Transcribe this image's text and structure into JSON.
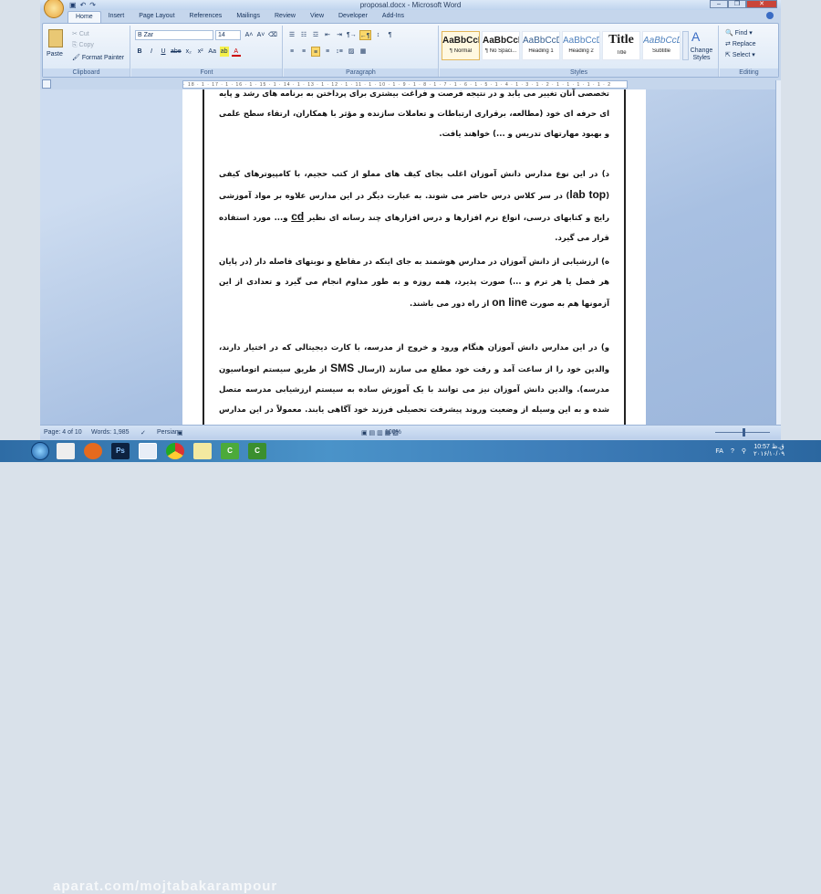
{
  "window": {
    "title": "proposal.docx - Microsoft Word"
  },
  "tabs": [
    "Home",
    "Insert",
    "Page Layout",
    "References",
    "Mailings",
    "Review",
    "View",
    "Developer",
    "Add-Ins"
  ],
  "clipboard": {
    "paste": "Paste",
    "cut": "Cut",
    "copy": "Copy",
    "format_painter": "Format Painter",
    "label": "Clipboard"
  },
  "font": {
    "name": "B Zar",
    "size": "14",
    "label": "Font",
    "buttons": [
      "B",
      "I",
      "U",
      "abe",
      "x₂",
      "x²",
      "Aa",
      "ab",
      "A"
    ]
  },
  "paragraph": {
    "label": "Paragraph"
  },
  "styles": {
    "label": "Styles",
    "items": [
      {
        "sample": "AaBbCcDdEe",
        "name": "¶ Normal"
      },
      {
        "sample": "AaBbCcDdEe",
        "name": "¶ No Spaci..."
      },
      {
        "sample": "AaBbCcDdEe",
        "name": "Heading 1"
      },
      {
        "sample": "AaBbCcDdEe",
        "name": "Heading 2"
      },
      {
        "sample": "Title",
        "name": "Title"
      },
      {
        "sample": "AaBbCcDdEe",
        "name": "Subtitle"
      }
    ],
    "change_styles": "Change Styles"
  },
  "editing": {
    "label": "Editing",
    "find": "Find",
    "replace": "Replace",
    "select": "Select"
  },
  "ruler": "· 18 · 1 · 17 · 1 · 16 · 1 · 15 · 1 · 14 · 1 · 13 · 1 · 12 · 1 · 11 · 1 · 10 · 1 · 9 · 1 · 8 · 1 · 7 · 1 · 6 · 1 · 5 · 1 · 4 · 1 · 3 · 1 · 2 · 1 · 1 · 1 · 1 · 1 · 2",
  "document": {
    "p1": "تخصصی آنان تغییر می یابد و در نتیجه فرصت و فراغت بیشتری برای پرداختن به برنامه های رشد و پایه ای حرفه ای خود (مطالعه، برقراری ارتباطات و تعاملات سازنده و مؤثر با همکاران، ارتقاء سطح علمی و بهبود مهارتهای تدریس و ...) خواهند یافت.",
    "p2a": "د) در این نوع مدارس دانش آموزان اغلب بجای کیف های مملو از کتب حجیم، با کامپیوترهای کیفی (",
    "p2_lab": "lab",
    "p2_top": "top",
    "p2b": ") در سر کلاس درس حاضر می شوند. به عبارت دیگر در این مدارس علاوه بر مواد آموزشی رایج و کتابهای درسی، انواع نرم افزارها و درس افزارهای چند رسانه ای نظیر ",
    "p2_cd": "cd",
    "p2c": " و... مورد استفاده قرار می گیرد.",
    "p3a": "ه) ارزشیابی از دانش آموزان در مدارس هوشمند به جای اینکه در مقاطع و نوبتهای فاصله دار (در پایان هر فصل یا هر ترم و ...) صورت پذیرد، همه روزه و به طور مداوم انجام می گیرد و تعدادی از این آزمونها هم به صورت ",
    "p3_online": "on line",
    "p3b": " از راه دور می باشند.",
    "p4a": "و) در این مدارس دانش آموزان هنگام ورود و خروج از مدرسه، با کارت دیجیتالی که در اختیار دارند، والدین خود را از ساعت آمد و رفت خود مطلع می سازند (ارسال ",
    "p4_sms": "SMS",
    "p4b": " از طریق سیستم اتوماسیون مدرسه). والدین دانش آموزان نیز می توانند با یک آموزش ساده به سیستم ارزشیابی مدرسه متصل شده و به این وسیله از وضعیت وروند پیشرفت تحصیلی فرزند خود آگاهی یابند. معمولاً در این مدارس روزانه در پایان ساعات"
  },
  "status": {
    "page": "Page: 4 of 10",
    "words": "Words: 1,985",
    "language": "Persian",
    "zoom": "100%",
    "zoom_fraction": 0.5
  },
  "taskbar": {
    "watermark": "aparat.com/mojtabakarampour",
    "lang": "FA",
    "time": "10:57 ق.ظ",
    "date": "۲۰۱۶/۱۰/۰۹",
    "apps": [
      "explorer",
      "firefox",
      "photoshop",
      "word",
      "chrome",
      "notepad",
      "camtasia-recorder",
      "camtasia"
    ]
  }
}
